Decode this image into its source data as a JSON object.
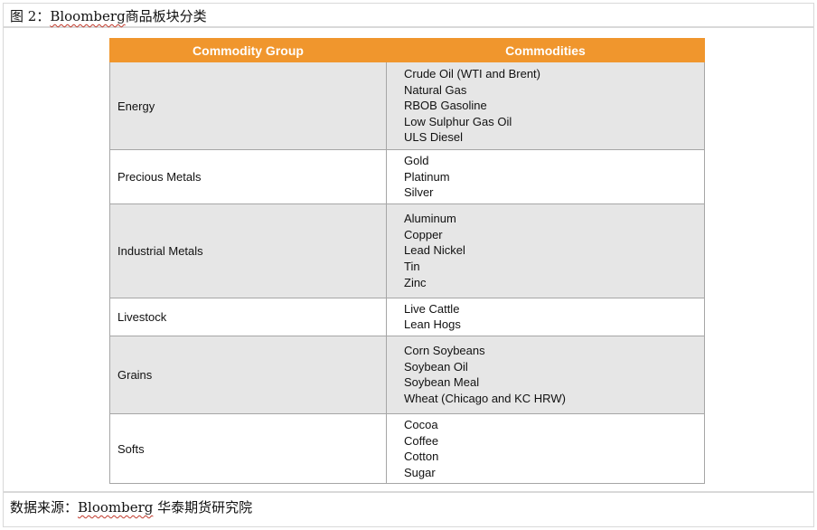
{
  "figure": {
    "prefix": "图 2：",
    "source_name": "Bloomberg",
    "caption": "商品板块分类"
  },
  "table": {
    "headers": [
      "Commodity Group",
      "Commodities"
    ],
    "rows": [
      {
        "group": "Energy",
        "items": [
          "Crude Oil (WTI and Brent)",
          "Natural Gas",
          "RBOB Gasoline",
          "Low Sulphur Gas Oil",
          "ULS Diesel"
        ]
      },
      {
        "group": "Precious Metals",
        "items": [
          "Gold",
          "Platinum",
          "Silver"
        ]
      },
      {
        "group": "Industrial Metals",
        "items": [
          "Aluminum",
          "Copper",
          "Lead Nickel",
          "Tin",
          "Zinc"
        ]
      },
      {
        "group": "Livestock",
        "items": [
          "Live Cattle",
          "Lean Hogs"
        ]
      },
      {
        "group": "Grains",
        "items": [
          "Corn Soybeans",
          "Soybean Oil",
          "Soybean Meal",
          "Wheat (Chicago and KC HRW)"
        ]
      },
      {
        "group": "Softs",
        "items": [
          "Cocoa",
          "Coffee",
          "Cotton",
          "Sugar"
        ]
      }
    ]
  },
  "footer": {
    "prefix": "数据来源：",
    "source_name": "Bloomberg",
    "suffix": "华泰期货研究院"
  },
  "colors": {
    "header_bg": "#f0962d",
    "shaded_row": "#e6e6e6"
  }
}
